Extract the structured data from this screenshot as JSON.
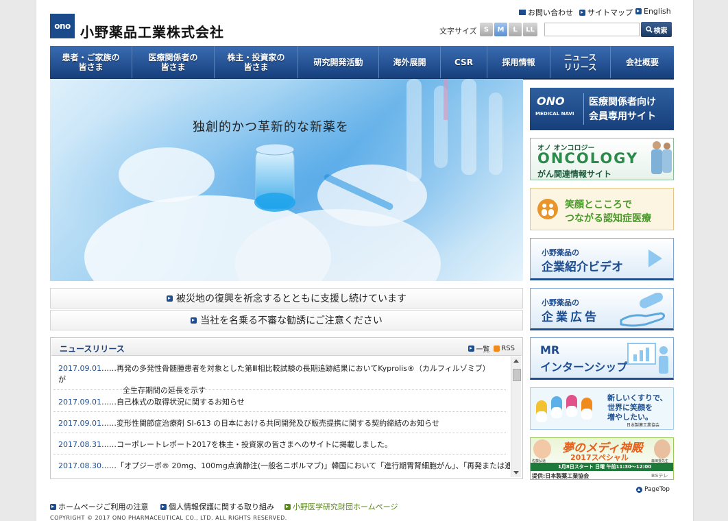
{
  "header": {
    "logo_mark": "ono",
    "company_name": "小野薬品工業株式会社",
    "util_links": {
      "contact": "お問い合わせ",
      "sitemap": "サイトマップ",
      "english": "English"
    },
    "font_size_label": "文字サイズ",
    "font_sizes": [
      "S",
      "M",
      "L",
      "LL"
    ],
    "font_size_selected": "M",
    "search_placeholder": "",
    "search_button": "検索"
  },
  "nav": {
    "items": [
      {
        "line1": "患者・ご家族の",
        "line2": "皆さま"
      },
      {
        "line1": "医療関係者の",
        "line2": "皆さま"
      },
      {
        "line1": "株主・投資家の",
        "line2": "皆さま"
      },
      {
        "line1": "研究開発活動",
        "line2": ""
      },
      {
        "line1": "海外展開",
        "line2": ""
      },
      {
        "line1": "CSR",
        "line2": ""
      },
      {
        "line1": "採用情報",
        "line2": ""
      },
      {
        "line1": "ニュース",
        "line2": "リリース"
      },
      {
        "line1": "会社概要",
        "line2": ""
      }
    ]
  },
  "hero": {
    "caption": "独創的かつ革新的な新薬を"
  },
  "notices": [
    "被災地の復興を祈念するとともに支援し続けています",
    "当社を名乗る不審な勧誘にご注意ください"
  ],
  "news": {
    "title": "ニュースリリース",
    "list_link": "一覧",
    "rss_link": "RSS",
    "items": [
      {
        "date": "2017.09.01",
        "text": "……再発の多発性骨髄腫患者を対象とした第Ⅲ相比較試験の長期追跡結果においてKyprolis®（カルフィルゾミブ）が",
        "text2": "全生存期間の延長を示す"
      },
      {
        "date": "2017.09.01",
        "text": "……自己株式の取得状況に関するお知らせ",
        "text2": ""
      },
      {
        "date": "2017.09.01",
        "text": "……変形性関節症治療剤 SI-613 の日本における共同開発及び販売提携に関する契約締結のお知らせ",
        "text2": ""
      },
      {
        "date": "2017.08.31",
        "text": "……コーポレートレポート2017を株主・投資家の皆さまへのサイトに掲載しました。",
        "text2": ""
      },
      {
        "date": "2017.08.30",
        "text": "……「オプジーボ® 20mg、100mg点滴静注(一般名ニボルマブ)」韓国において「進行期胃腎細胞がん」、「再発または進",
        "text2": ""
      }
    ]
  },
  "banners": {
    "medical_navi": {
      "logo": "ONO",
      "sub": "MEDICAL NAVI",
      "line1": "医療関係者向け",
      "line2": "会員専用サイト"
    },
    "oncology": {
      "kana": "オノ オンコロジー",
      "title": "ONCOLOGY",
      "sub": "がん関連情報サイト"
    },
    "dementia": {
      "line1": "笑顔とこころで",
      "line2": "つながる認知症医療"
    },
    "video": {
      "small": "小野薬品の",
      "big": "企業紹介ビデオ"
    },
    "ad": {
      "small": "小野薬品の",
      "big": "企業広告"
    },
    "intern": {
      "line1": "MR",
      "line2": "インターンシップ"
    },
    "jpma": {
      "line1": "新しいくすりで、",
      "line2": "世界に笑顔を",
      "line3": "増やしたい。",
      "org": "日本製薬工業協会"
    },
    "yume": {
      "title": "夢のメディ神殿",
      "special": "2017スペシャル",
      "schedule": "1月8日スタート 日曜 午前11:30～12:00",
      "sponsor": "提供:日本製薬工業協会",
      "channel": "BSテレ",
      "left_name": "佐藤弘道",
      "right_name": "森田豊先生"
    }
  },
  "footer": {
    "links": [
      "ホームページご利用の注意",
      "個人情報保護に関する取り組み",
      "小野医学研究財団ホームページ"
    ],
    "page_top": "PageTop",
    "copyright": "COPYRIGHT © 2017 ONO PHARMACEUTICAL CO., LTD. ALL RIGHTS RESERVED."
  },
  "colors": {
    "brand": "#1a4a8a",
    "nav": "#1d4c8f",
    "accent_green": "#5a8a1a"
  }
}
